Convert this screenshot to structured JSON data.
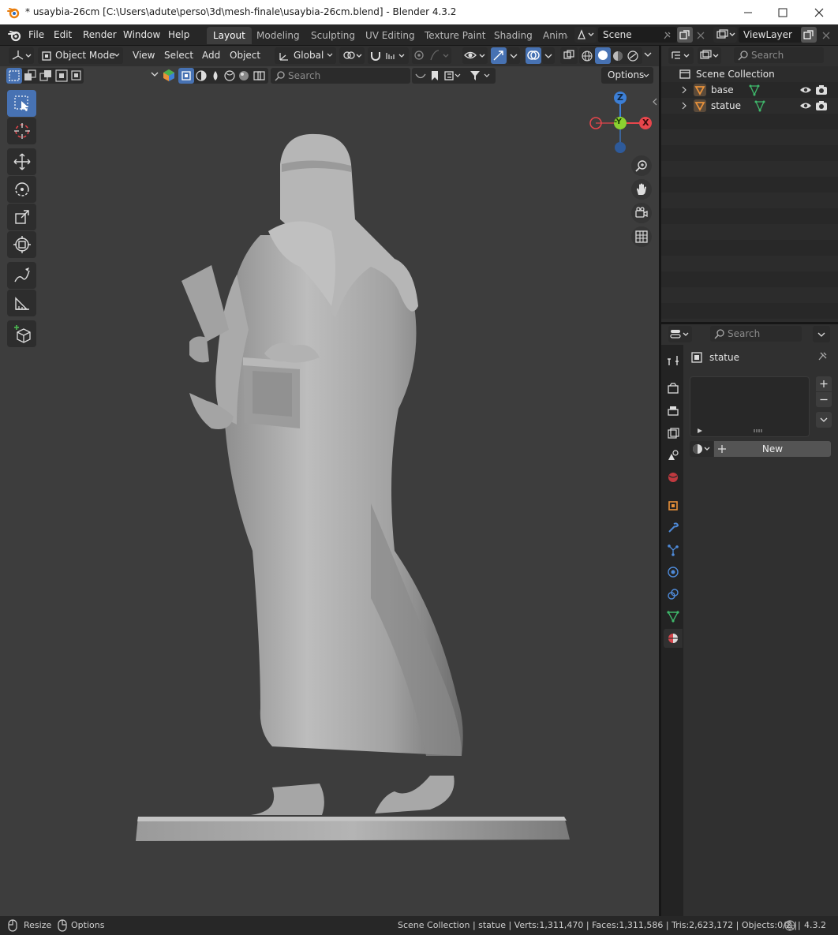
{
  "window": {
    "title": "* usaybia-26cm [C:\\Users\\adute\\perso\\3d\\mesh-finale\\usaybia-26cm.blend] - Blender 4.3.2"
  },
  "menu": {
    "file": "File",
    "edit": "Edit",
    "render": "Render",
    "window": "Window",
    "help": "Help"
  },
  "workspaces": [
    "Layout",
    "Modeling",
    "Sculpting",
    "UV Editing",
    "Texture Paint",
    "Shading",
    "Anima"
  ],
  "scene": {
    "label": "Scene",
    "view_layer": "ViewLayer"
  },
  "viewport_header": {
    "mode": "Object Mode",
    "view": "View",
    "select": "Select",
    "add": "Add",
    "object": "Object",
    "transform_orientation": "Global",
    "search_placeholder": "Search",
    "options": "Options"
  },
  "navigation_gizmo": {
    "z": "Z",
    "y": "-Y",
    "x": "X"
  },
  "outliner": {
    "search_placeholder": "Search",
    "root": "Scene Collection",
    "items": [
      {
        "name": "base"
      },
      {
        "name": "statue"
      }
    ]
  },
  "properties": {
    "search_placeholder": "Search",
    "object_name": "statue",
    "new_button": "New"
  },
  "statusbar": {
    "resize": "Resize",
    "options": "Options",
    "stats": "Scene Collection | statue | Verts:1,311,470 | Faces:1,311,586 | Tris:2,623,172 | Objects:0/2 |",
    "version": "4.3.2"
  },
  "colors": {
    "accent": "#4772b3",
    "axis_x": "#e8464c",
    "axis_y": "#8bd030",
    "axis_z": "#3c7fd6",
    "object_orange": "#e8913a",
    "mesh_green": "#3fb86b"
  }
}
